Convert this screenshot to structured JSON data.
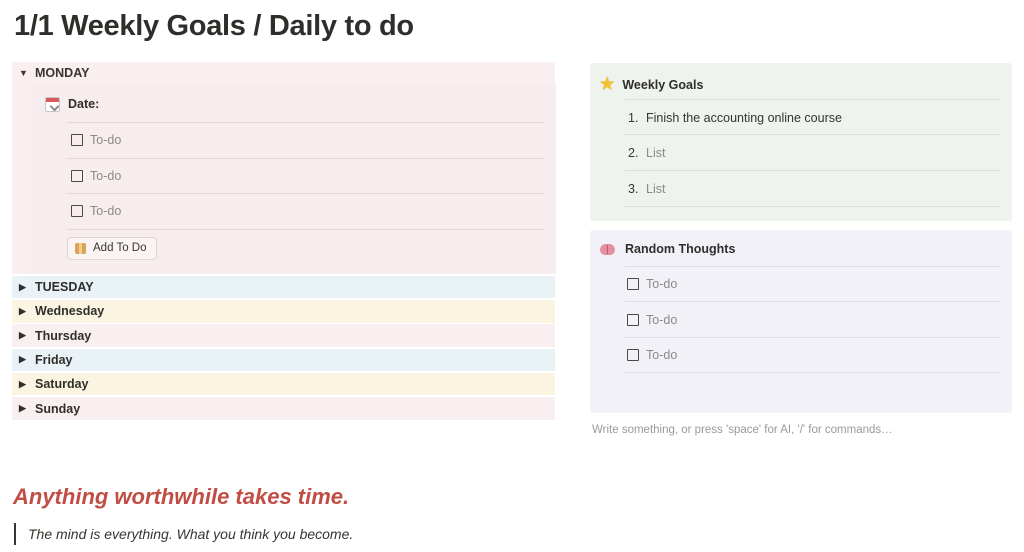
{
  "page": {
    "title": "1/1 Weekly Goals / Daily to do"
  },
  "days": {
    "monday": {
      "label": "MONDAY",
      "date_label": "Date:",
      "todos": [
        "To-do",
        "To-do",
        "To-do"
      ],
      "add_button_label": "Add To Do"
    },
    "collapsed": [
      {
        "label": "TUESDAY",
        "color": "#e9f2f7"
      },
      {
        "label": "Wednesday",
        "color": "#faf4e1"
      },
      {
        "label": "Thursday",
        "color": "#f9eef0"
      },
      {
        "label": "Friday",
        "color": "#e9f2f7"
      },
      {
        "label": "Saturday",
        "color": "#faf4e1"
      },
      {
        "label": "Sunday",
        "color": "#f9eef0"
      }
    ]
  },
  "weekly_goals": {
    "title": "Weekly Goals",
    "icon": "star-icon",
    "items": [
      {
        "num": "1.",
        "text": "Finish the accounting online course"
      },
      {
        "num": "2.",
        "text": "List"
      },
      {
        "num": "3.",
        "text": "List"
      }
    ]
  },
  "random_thoughts": {
    "title": "Random Thoughts",
    "icon": "brain-icon",
    "todos": [
      "To-do",
      "To-do",
      "To-do"
    ]
  },
  "editor": {
    "placeholder": "Write something, or press 'space' for AI, '/' for commands…"
  },
  "footer": {
    "heading": "Anything worthwhile takes time.",
    "quote": "The mind is everything. What you think you become."
  },
  "colors": {
    "pink": "#f9eef0",
    "blue": "#e9f2f7",
    "yellow": "#faf4e1",
    "green_callout": "#eef3ed",
    "purple_callout": "#f3f1f8",
    "heading_red": "#c14d44"
  }
}
